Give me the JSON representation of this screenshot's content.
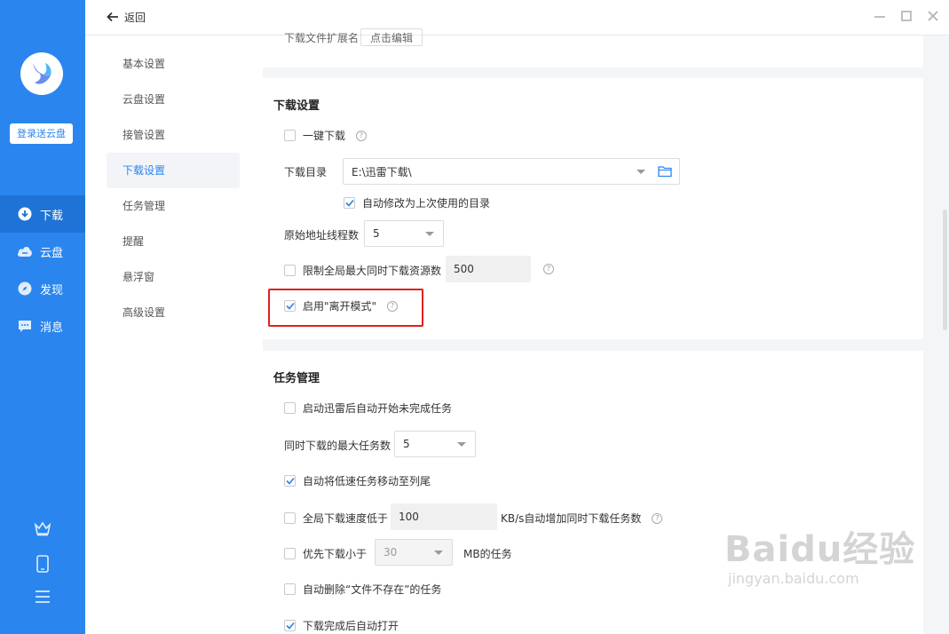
{
  "rail": {
    "login_button": "登录送云盘",
    "nav": [
      {
        "label": "下载",
        "icon": "download-icon",
        "active": true
      },
      {
        "label": "云盘",
        "icon": "cloud-icon",
        "active": false
      },
      {
        "label": "发现",
        "icon": "compass-icon",
        "active": false
      },
      {
        "label": "消息",
        "icon": "message-icon",
        "active": false
      }
    ],
    "bottom_icons": [
      "crown-icon",
      "phone-icon",
      "menu-icon"
    ]
  },
  "topbar": {
    "back_label": "返回",
    "window_controls": [
      "minimize-icon",
      "maximize-icon",
      "close-icon"
    ]
  },
  "sidebar": {
    "items": [
      {
        "label": "基本设置",
        "active": false
      },
      {
        "label": "云盘设置",
        "active": false
      },
      {
        "label": "接管设置",
        "active": false
      },
      {
        "label": "下载设置",
        "active": true
      },
      {
        "label": "任务管理",
        "active": false
      },
      {
        "label": "提醒",
        "active": false
      },
      {
        "label": "悬浮窗",
        "active": false
      },
      {
        "label": "高级设置",
        "active": false
      }
    ]
  },
  "top_partial": {
    "label": "下载文件扩展名",
    "button": "点击编辑"
  },
  "download_settings": {
    "title": "下载设置",
    "one_click": {
      "label": "一键下载",
      "checked": false
    },
    "dir_label": "下载目录",
    "dir_value": "E:\\迅雷下载\\",
    "auto_modify": {
      "label": "自动修改为上次使用的目录",
      "checked": true
    },
    "threads_label": "原始地址线程数",
    "threads_value": "5",
    "limit": {
      "label": "限制全局最大同时下载资源数",
      "checked": false,
      "value": "500"
    },
    "leave_mode": {
      "label": "启用\"离开模式\"",
      "checked": true
    }
  },
  "task_management": {
    "title": "任务管理",
    "auto_start": {
      "label": "启动迅雷后自动开始未完成任务",
      "checked": false
    },
    "max_tasks_label": "同时下载的最大任务数",
    "max_tasks_value": "5",
    "move_slow": {
      "label": "自动将低速任务移动至列尾",
      "checked": true
    },
    "speed_low": {
      "label": "全局下载速度低于",
      "checked": false,
      "value": "100",
      "suffix": "KB/s自动增加同时下载任务数"
    },
    "priority_small": {
      "label": "优先下载小于",
      "checked": false,
      "value": "30",
      "suffix": "MB的任务"
    },
    "auto_delete": {
      "label": "自动删除“文件不存在”的任务",
      "checked": false
    },
    "auto_open": {
      "label": "下载完成后自动打开",
      "checked": true
    }
  },
  "watermark": {
    "brand": "Baidu经验",
    "url": "jingyan.baidu.com"
  },
  "colors": {
    "accent": "#2a86ee",
    "rail_active": "#1f73d6",
    "highlight": "#e02020"
  }
}
